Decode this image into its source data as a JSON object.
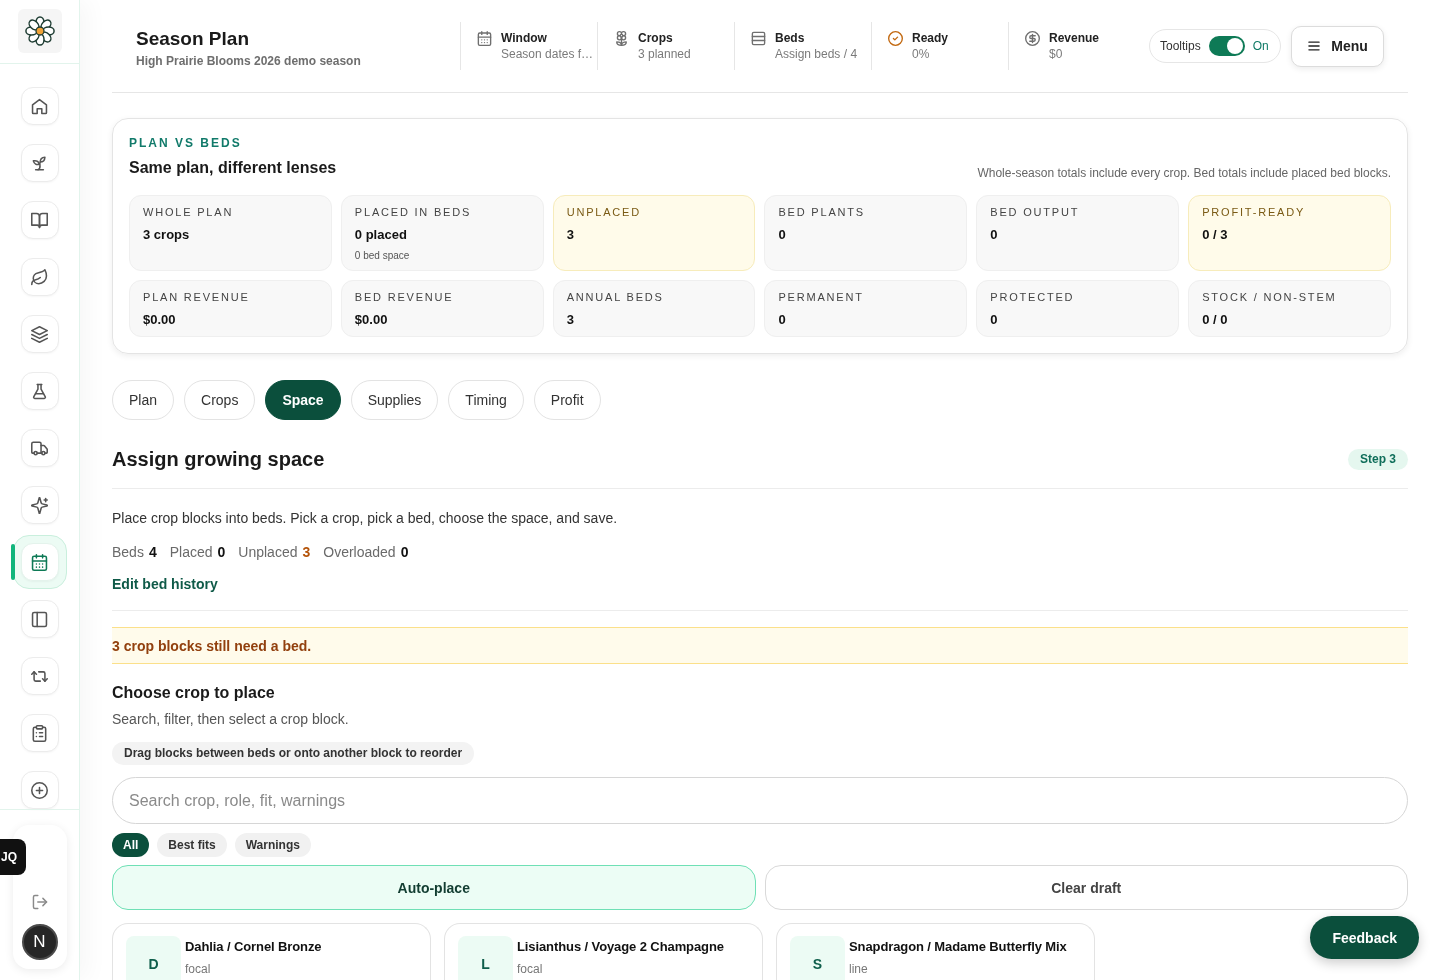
{
  "sidebar": {
    "items": [
      {
        "selected": false
      },
      {
        "selected": false
      },
      {
        "selected": false
      },
      {
        "selected": false
      },
      {
        "selected": false
      },
      {
        "selected": false
      },
      {
        "selected": false
      },
      {
        "selected": false
      },
      {
        "selected": true
      },
      {
        "selected": false
      },
      {
        "selected": false
      },
      {
        "selected": false
      },
      {
        "selected": false
      }
    ]
  },
  "account": {
    "badge": "JQ",
    "avatar": "N"
  },
  "header": {
    "title": "Season Plan",
    "subtitle": "High Prairie Blooms 2026 demo season",
    "stats": [
      {
        "label": "Window",
        "value": "Season dates f…"
      },
      {
        "label": "Crops",
        "value": "3 planned"
      },
      {
        "label": "Beds",
        "value": "Assign beds / 4"
      },
      {
        "label": "Ready",
        "value": "0%"
      },
      {
        "label": "Revenue",
        "value": "$0"
      }
    ],
    "tooltips": {
      "label": "Tooltips",
      "on": true,
      "state": "On"
    },
    "menu": "Menu"
  },
  "plan_vs_beds": {
    "eyebrow": "PLAN VS BEDS",
    "title": "Same plan, different lenses",
    "note": "Whole-season totals include every crop. Bed totals include placed bed blocks.",
    "tiles": [
      {
        "label": "WHOLE PLAN",
        "value": "3 crops",
        "highlighted": false
      },
      {
        "label": "PLACED IN BEDS",
        "value": "0 placed",
        "detail": "0 bed space",
        "highlighted": false
      },
      {
        "label": "UNPLACED",
        "value": "3",
        "highlighted": true
      },
      {
        "label": "BED PLANTS",
        "value": "0",
        "highlighted": false
      },
      {
        "label": "BED OUTPUT",
        "value": "0",
        "highlighted": false
      },
      {
        "label": "PROFIT-READY",
        "value": "0 / 3",
        "highlighted": true
      },
      {
        "label": "PLAN REVENUE",
        "value": "$0.00",
        "highlighted": false
      },
      {
        "label": "BED REVENUE",
        "value": "$0.00",
        "highlighted": false
      },
      {
        "label": "ANNUAL BEDS",
        "value": "3",
        "highlighted": false
      },
      {
        "label": "PERMANENT",
        "value": "0",
        "highlighted": false
      },
      {
        "label": "PROTECTED",
        "value": "0",
        "highlighted": false
      },
      {
        "label": "STOCK / NON-STEM",
        "value": "0 / 0",
        "highlighted": false
      }
    ]
  },
  "tabs": [
    {
      "label": "Plan",
      "selected": false
    },
    {
      "label": "Crops",
      "selected": false
    },
    {
      "label": "Space",
      "selected": true
    },
    {
      "label": "Supplies",
      "selected": false
    },
    {
      "label": "Timing",
      "selected": false
    },
    {
      "label": "Profit",
      "selected": false
    }
  ],
  "section": {
    "title": "Assign growing space",
    "step": "Step 3",
    "description": "Place crop blocks into beds. Pick a crop, pick a bed, choose the space, and save.",
    "counts": [
      {
        "label": "Beds",
        "value": "4",
        "warning": false
      },
      {
        "label": "Placed",
        "value": "0",
        "warning": false
      },
      {
        "label": "Unplaced",
        "value": "3",
        "warning": true
      },
      {
        "label": "Overloaded",
        "value": "0",
        "warning": false
      }
    ],
    "link": "Edit bed history",
    "alert": "3 crop blocks still need a bed."
  },
  "picker": {
    "title": "Choose crop to place",
    "subtitle": "Search, filter, then select a crop block.",
    "hint": "Drag blocks between beds or onto another block to reorder",
    "search": {
      "placeholder": "Search crop, role, fit, warnings"
    },
    "filters": [
      {
        "label": "All",
        "selected": true
      },
      {
        "label": "Best fits",
        "selected": false
      },
      {
        "label": "Warnings",
        "selected": false
      }
    ],
    "actions": [
      {
        "label": "Auto-place",
        "kind": "primary"
      },
      {
        "label": "Clear draft",
        "kind": "secondary"
      }
    ],
    "crops": [
      {
        "initial": "D",
        "name": "Dahlia / Cornel Bronze",
        "role": "focal"
      },
      {
        "initial": "L",
        "name": "Lisianthus / Voyage 2 Champagne",
        "role": "focal"
      },
      {
        "initial": "S",
        "name": "Snapdragon / Madame Butterfly Mix",
        "role": "line"
      }
    ]
  },
  "feedback": "Feedback"
}
